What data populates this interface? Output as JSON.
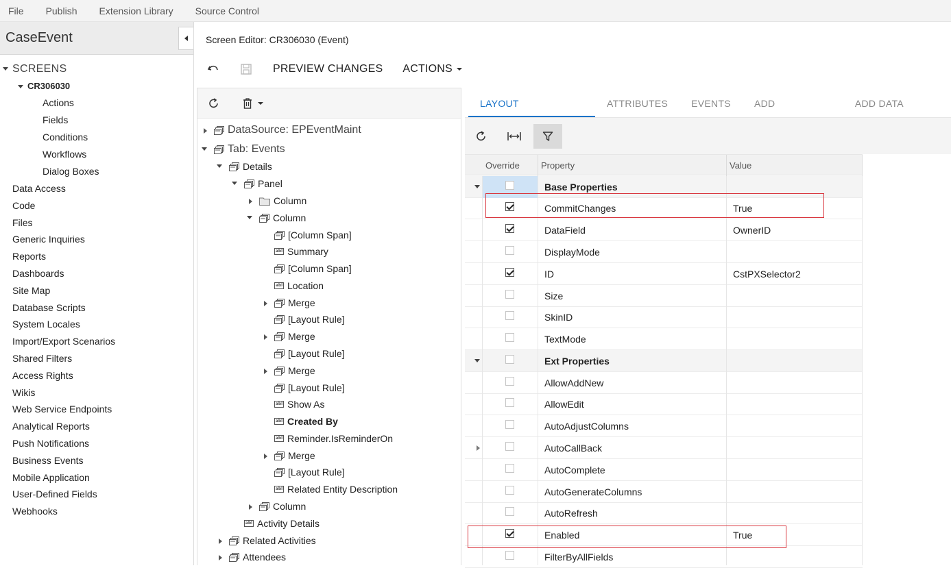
{
  "top_menu": [
    "File",
    "Publish",
    "Extension Library",
    "Source Control"
  ],
  "sidebar": {
    "title": "CaseEvent",
    "screens_label": "SCREENS",
    "screen_id": "CR306030",
    "screen_children": [
      "Actions",
      "Fields",
      "Conditions",
      "Workflows",
      "Dialog Boxes"
    ],
    "items": [
      "Data Access",
      "Code",
      "Files",
      "Generic Inquiries",
      "Reports",
      "Dashboards",
      "Site Map",
      "Database Scripts",
      "System Locales",
      "Import/Export Scenarios",
      "Shared Filters",
      "Access Rights",
      "Wikis",
      "Web Service Endpoints",
      "Analytical Reports",
      "Push Notifications",
      "Business Events",
      "Mobile Application",
      "User-Defined Fields",
      "Webhooks"
    ]
  },
  "editor": {
    "title": "Screen Editor: CR306030 (Event)",
    "preview_label": "PREVIEW CHANGES",
    "actions_label": "ACTIONS"
  },
  "tree": [
    {
      "label": "DataSource: EPEventMaint",
      "icon": "container-icon",
      "expander": "collapsed",
      "big": true
    },
    {
      "label": "Tab: Events",
      "icon": "container-icon",
      "expander": "expanded",
      "big": true
    },
    {
      "label": "Details",
      "icon": "container-icon",
      "expander": "expanded"
    },
    {
      "label": "Panel",
      "icon": "container-icon",
      "expander": "expanded"
    },
    {
      "label": "Column",
      "icon": "folder-icon",
      "expander": "collapsed"
    },
    {
      "label": "Column",
      "icon": "container-icon",
      "expander": "expanded"
    },
    {
      "label": "[Column Span]",
      "icon": "container-icon",
      "expander": "none"
    },
    {
      "label": "Summary",
      "icon": "field-icon",
      "expander": "none"
    },
    {
      "label": "[Column Span]",
      "icon": "container-icon",
      "expander": "none"
    },
    {
      "label": "Location",
      "icon": "field-icon",
      "expander": "none"
    },
    {
      "label": "Merge",
      "icon": "container-icon",
      "expander": "collapsed"
    },
    {
      "label": "[Layout Rule]",
      "icon": "container-icon",
      "expander": "none"
    },
    {
      "label": "Merge",
      "icon": "container-icon",
      "expander": "collapsed"
    },
    {
      "label": "[Layout Rule]",
      "icon": "container-icon",
      "expander": "none"
    },
    {
      "label": "Merge",
      "icon": "container-icon",
      "expander": "collapsed"
    },
    {
      "label": "[Layout Rule]",
      "icon": "container-icon",
      "expander": "none"
    },
    {
      "label": "Show As",
      "icon": "field-icon",
      "expander": "none"
    },
    {
      "label": "Created By",
      "icon": "field-icon",
      "expander": "none",
      "bold": true
    },
    {
      "label": "Reminder.IsReminderOn",
      "icon": "field-icon",
      "expander": "none"
    },
    {
      "label": "Merge",
      "icon": "container-icon",
      "expander": "collapsed"
    },
    {
      "label": "[Layout Rule]",
      "icon": "container-icon",
      "expander": "none"
    },
    {
      "label": "Related Entity Description",
      "icon": "field-icon",
      "expander": "none"
    },
    {
      "label": "Column",
      "icon": "container-icon",
      "expander": "collapsed"
    },
    {
      "label": "Activity Details",
      "icon": "field-icon",
      "expander": "none"
    },
    {
      "label": "Related Activities",
      "icon": "container-icon",
      "expander": "collapsed"
    },
    {
      "label": "Attendees",
      "icon": "container-icon",
      "expander": "collapsed"
    }
  ],
  "tabs": [
    "LAYOUT PROPERTIES",
    "ATTRIBUTES",
    "EVENTS",
    "ADD CONTROLS",
    "ADD DATA FIELDS"
  ],
  "active_tab": "LAYOUT PROPERTIES",
  "grid": {
    "headers": {
      "override": "Override",
      "property": "Property",
      "value": "Value"
    },
    "rows": [
      {
        "property": "Base Properties",
        "value": "",
        "override": false,
        "group": true
      },
      {
        "property": "CommitChanges",
        "value": "True",
        "override": true,
        "highlight": true
      },
      {
        "property": "DataField",
        "value": "OwnerID",
        "override": true
      },
      {
        "property": "DisplayMode",
        "value": "",
        "override": false
      },
      {
        "property": "ID",
        "value": "CstPXSelector2",
        "override": true
      },
      {
        "property": "Size",
        "value": "",
        "override": false
      },
      {
        "property": "SkinID",
        "value": "",
        "override": false
      },
      {
        "property": "TextMode",
        "value": "",
        "override": false
      },
      {
        "property": "Ext Properties",
        "value": "",
        "override": false,
        "group": true
      },
      {
        "property": "AllowAddNew",
        "value": "",
        "override": false
      },
      {
        "property": "AllowEdit",
        "value": "",
        "override": false
      },
      {
        "property": "AutoAdjustColumns",
        "value": "",
        "override": false
      },
      {
        "property": "AutoCallBack",
        "value": "",
        "override": false,
        "expander": "collapsed"
      },
      {
        "property": "AutoComplete",
        "value": "",
        "override": false
      },
      {
        "property": "AutoGenerateColumns",
        "value": "",
        "override": false
      },
      {
        "property": "AutoRefresh",
        "value": "",
        "override": false
      },
      {
        "property": "Enabled",
        "value": "True",
        "override": true,
        "highlight": true
      },
      {
        "property": "FilterByAllFields",
        "value": "",
        "override": false
      }
    ]
  },
  "colors": {
    "accent": "#1a73c8",
    "highlight": "#d9363e",
    "selected_cell": "#cfe3f6"
  }
}
